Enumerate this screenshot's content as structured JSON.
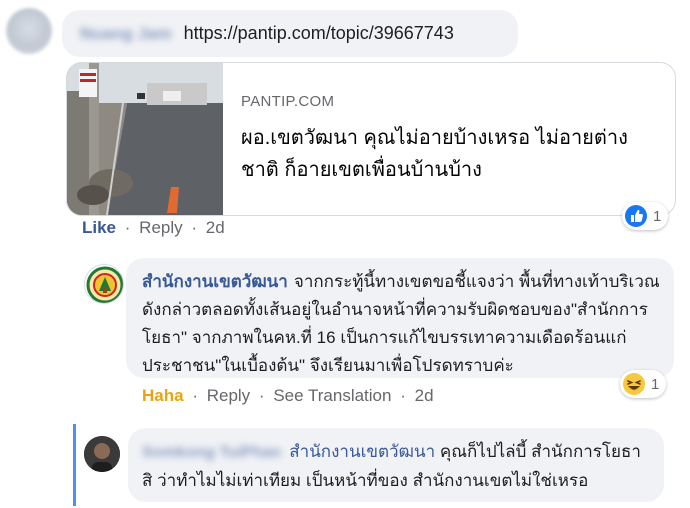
{
  "top_comment": {
    "author": "Nuang Jam",
    "link_text": "https://pantip.com/topic/39667743"
  },
  "link_preview": {
    "domain": "PANTIP.COM",
    "title": "ผอ.เขตวัฒนา คุณไม่อายบ้างเหรอ ไม่อายต่างชาติ ก็อายเขตเพื่อนบ้านบ้าง"
  },
  "comment_actions": {
    "like": "Like",
    "reply": "Reply",
    "time": "2d",
    "separator": "·"
  },
  "comment_reaction": {
    "icon": "like-icon",
    "count": "1"
  },
  "reply1": {
    "author": "สำนักงานเขตวัฒนา",
    "text": "จากกระทู้นี้ทางเขตขอชี้แจงว่า พื้นที่ทางเท้าบริเวณดังกล่าวตลอดทั้งเส้นอยู่ในอำนาจหน้าที่ความรับผิดชอบของ\"สำนักการโยธา\" จากภาพในคห.ที่ 16 เป็นการแก้ไขบรรเทาความเดือดร้อนแก่ประชาชน\"ในเบื้องต้น\" จึงเรียนมาเพื่อโปรดทราบค่ะ",
    "actions": {
      "haha": "Haha",
      "reply": "Reply",
      "see_translation": "See Translation",
      "time": "2d"
    },
    "reaction": {
      "icon": "haha-icon",
      "count": "1"
    }
  },
  "reply2": {
    "author": "Somkong TuiPhan",
    "tag": "สำนักงานเขตวัฒนา",
    "text": "คุณก็ไปไล่บี้ สำนักการโยธาสิ ว่าทำไมไม่เท่าเทียม เป็นหน้าที่ของ สำนักงานเขตไม่ใช่เหรอ"
  },
  "colors": {
    "link_blue": "#385898",
    "bubble_gray": "#f0f2f5",
    "like_blue": "#1877f2",
    "haha_yellow": "#f7c83d",
    "meta_gray": "#65676b"
  }
}
